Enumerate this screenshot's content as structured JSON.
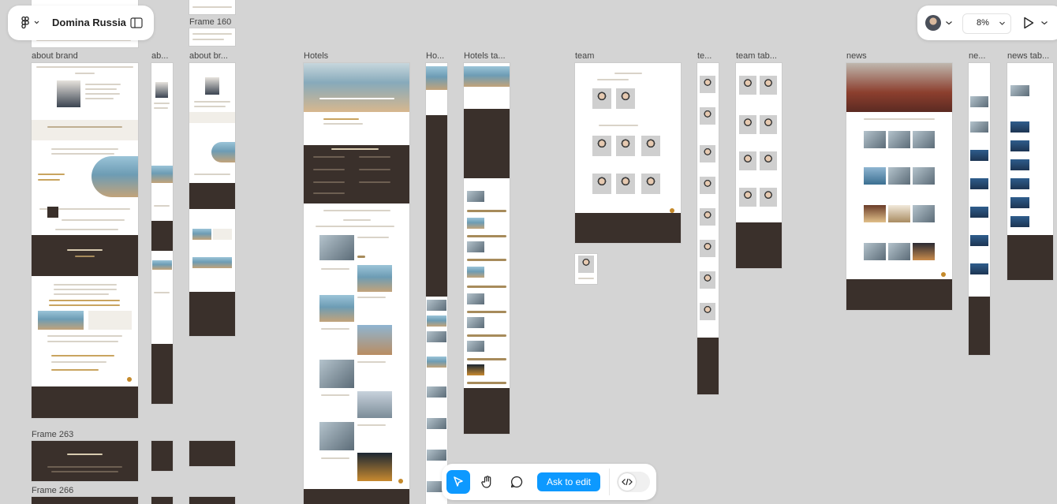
{
  "app": {
    "file_title": "Domina Russia",
    "zoom": "8%",
    "accent": "#0d99ff",
    "brand_dark": "#3a302b",
    "brand_gold": "#a78b5b"
  },
  "frames": {
    "about_brand": "about brand",
    "ab_short": "ab...",
    "about_br_short": "about br...",
    "frame_160": "Frame 160",
    "hotels": "Hotels",
    "ho_short": "Ho...",
    "hotels_ta": "Hotels ta...",
    "team": "team",
    "te_short": "te...",
    "team_tab": "team tab...",
    "news": "news",
    "ne_short": "ne...",
    "news_tab": "news tab...",
    "frame_263": "Frame 263",
    "frame_266": "Frame 266"
  },
  "toolbar": {
    "ask_to_edit": "Ask to edit"
  },
  "icons": {
    "figma": "figma-logo-icon",
    "sidebar": "sidebar-toggle-icon",
    "move": "move-tool-icon",
    "hand": "hand-tool-icon",
    "comment": "comment-icon",
    "dev": "dev-mode-icon",
    "play": "present-play-icon"
  }
}
